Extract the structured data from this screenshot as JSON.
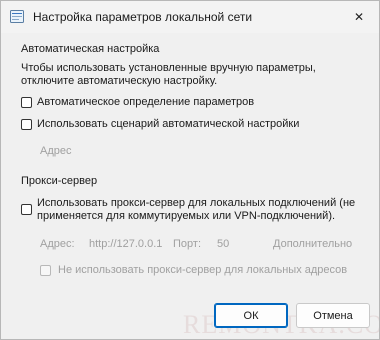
{
  "window": {
    "title": "Настройка параметров локальной сети",
    "icon": "network-settings-icon",
    "close_label": "✕"
  },
  "auto": {
    "heading": "Автоматическая настройка",
    "desc_line1": "Чтобы использовать установленные вручную параметры,",
    "desc_line2": "отключите автоматическую настройку.",
    "detect_label": "Автоматическое определение параметров",
    "detect_checked": false,
    "script_label": "Использовать сценарий автоматической настройки",
    "script_checked": false,
    "address_placeholder": "Адрес"
  },
  "proxy": {
    "heading": "Прокси-сервер",
    "use_line1": "Использовать прокси-сервер для локальных подключений (не",
    "use_line2": "применяется для коммутируемых или VPN-подключений).",
    "use_checked": false,
    "address_label": "Адрес:",
    "address_value": "http://127.0.0.1",
    "port_label": "Порт:",
    "port_value": "50",
    "advanced_label": "Дополнительно",
    "bypass_label": "Не использовать прокси-сервер для локальных адресов",
    "bypass_checked": false
  },
  "buttons": {
    "ok": "ОК",
    "cancel": "Отмена"
  },
  "watermark": "REMONTKA.COM",
  "colors": {
    "accent": "#0067c0",
    "disabled_text": "#a0a0a0",
    "background": "#f0f0f0"
  }
}
